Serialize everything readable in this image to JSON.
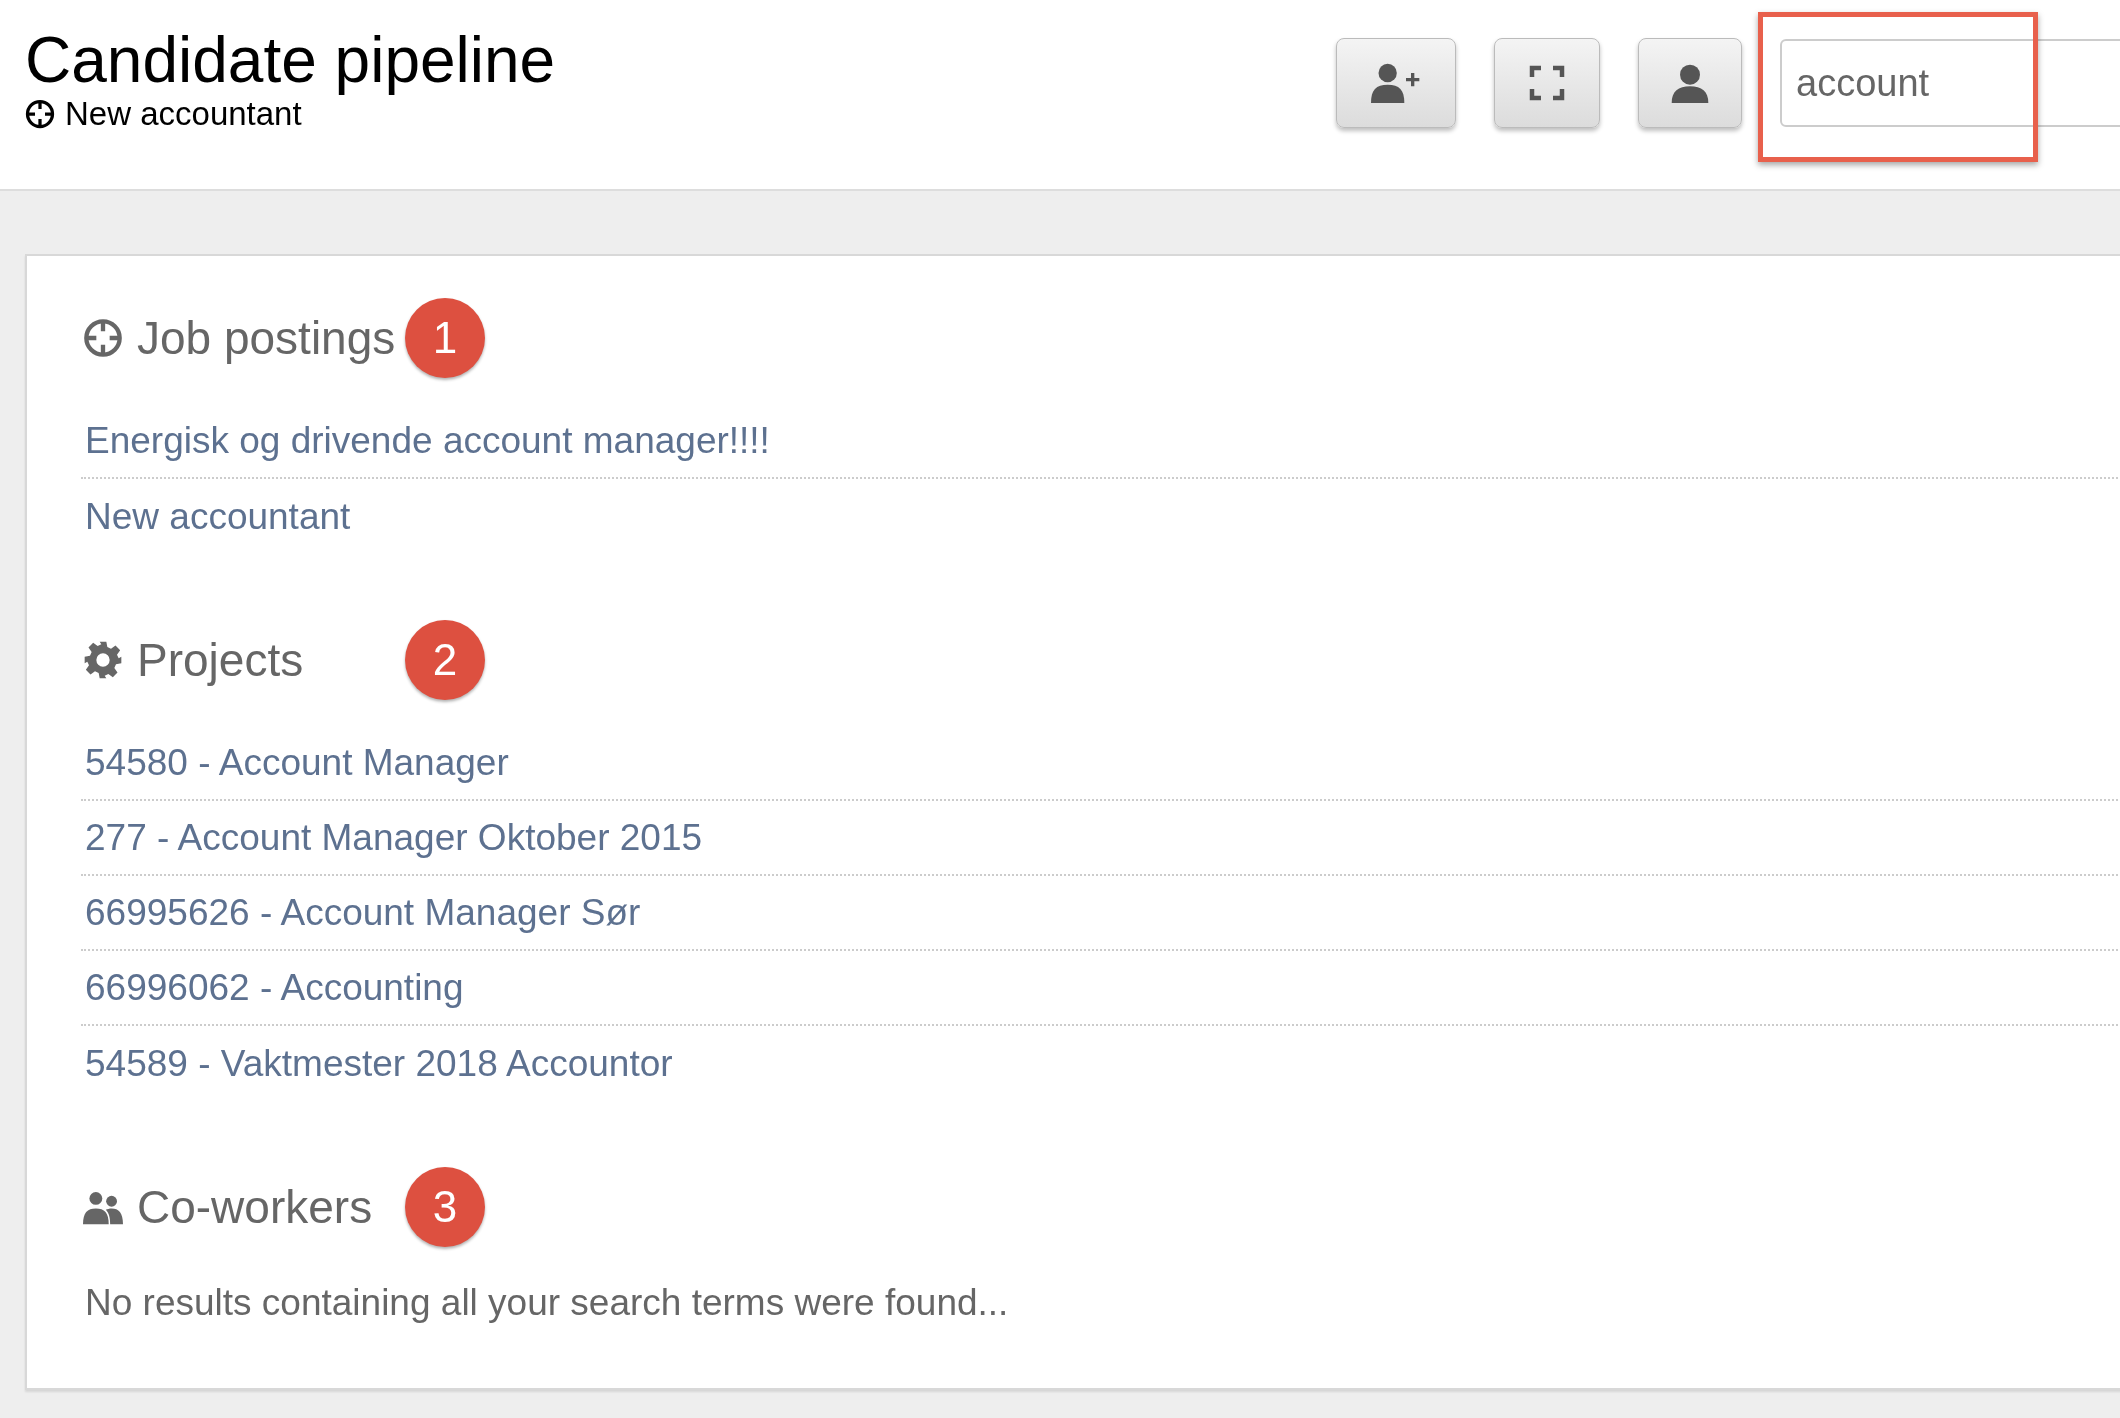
{
  "header": {
    "title": "Candidate pipeline",
    "subtitle": "New accountant",
    "search": {
      "value": "account",
      "highlighted": true
    }
  },
  "sections": [
    {
      "kind": "job_postings",
      "title": "Job postings",
      "badge": "1",
      "items": [
        "Energisk og drivende account manager!!!!",
        "New accountant"
      ]
    },
    {
      "kind": "projects",
      "title": "Projects",
      "badge": "2",
      "items": [
        "54580 - Account Manager",
        "277 - Account Manager Oktober 2015",
        "66995626 - Account Manager Sør",
        "66996062 - Accounting",
        "54589 - Vaktmester 2018 Accountor"
      ]
    },
    {
      "kind": "coworkers",
      "title": "Co-workers",
      "badge": "3",
      "message": "No results containing all your search terms were found..."
    }
  ]
}
